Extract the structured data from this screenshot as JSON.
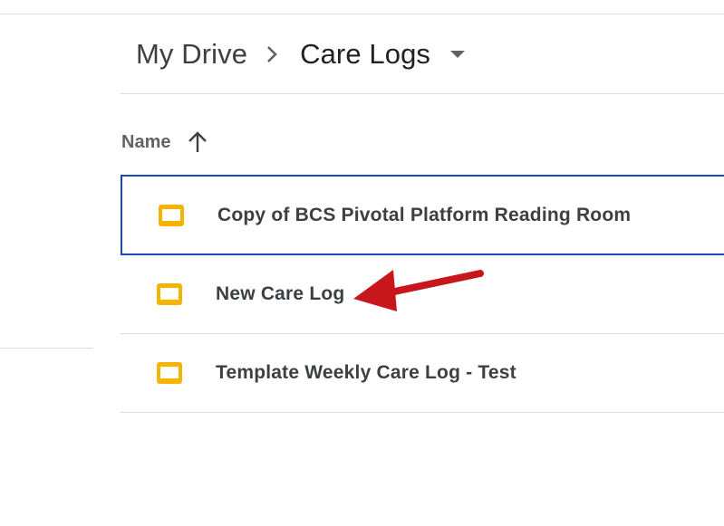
{
  "breadcrumb": {
    "root": "My Drive",
    "current": "Care Logs"
  },
  "list_header": {
    "name_label": "Name",
    "sort_direction": "ascending"
  },
  "files": [
    {
      "name": "Copy of BCS Pivotal Platform Reading Room",
      "type": "slides",
      "selected": true
    },
    {
      "name": "New Care Log",
      "type": "slides",
      "selected": false
    },
    {
      "name": "Template Weekly Care Log - Test",
      "type": "slides",
      "selected": false
    }
  ],
  "colors": {
    "slides_icon": "#F4B400",
    "selection_border": "#1A47C4",
    "annotation_arrow": "#C8161D",
    "divider": "#DADCE0"
  },
  "icons": {
    "breadcrumb_separator": "chevron-right-icon",
    "dropdown": "caret-down-icon",
    "sort": "arrow-up-icon",
    "file": "slides-icon",
    "annotation": "red-arrow-icon"
  }
}
